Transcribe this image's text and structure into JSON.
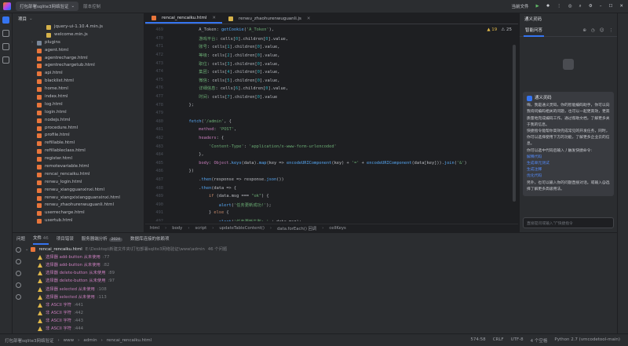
{
  "title_bar": {
    "project": "打包部署sqlite3网络验证",
    "branch": "版本控制",
    "run_config": "当前文件",
    "icons": [
      "run-icon",
      "debug-icon",
      "more-icon",
      "ai-icon",
      "search-icon",
      "settings-icon",
      "minimize-icon",
      "maximize-icon",
      "close-icon"
    ]
  },
  "project_panel": {
    "title": "项目",
    "items": [
      {
        "name": "jquery-ui-1.10.4.min.js",
        "type": "js",
        "indent": 3
      },
      {
        "name": "welcome.min.js",
        "type": "js",
        "indent": 3
      },
      {
        "name": "plugins",
        "type": "dir",
        "indent": 2,
        "chev": "›"
      },
      {
        "name": "agent.html",
        "type": "html",
        "indent": 2
      },
      {
        "name": "agentrecharge.html",
        "type": "html",
        "indent": 2
      },
      {
        "name": "agentrechargetub.html",
        "type": "html",
        "indent": 2
      },
      {
        "name": "api.html",
        "type": "html",
        "indent": 2
      },
      {
        "name": "blacklist.html",
        "type": "html",
        "indent": 2
      },
      {
        "name": "home.html",
        "type": "html",
        "indent": 2
      },
      {
        "name": "index.html",
        "type": "html",
        "indent": 2
      },
      {
        "name": "log.html",
        "type": "html",
        "indent": 2
      },
      {
        "name": "login.html",
        "type": "html",
        "indent": 2
      },
      {
        "name": "nodejs.html",
        "type": "html",
        "indent": 2
      },
      {
        "name": "procedure.html",
        "type": "html",
        "indent": 2
      },
      {
        "name": "profile.html",
        "type": "html",
        "indent": 2
      },
      {
        "name": "refillable.html",
        "type": "html",
        "indent": 2
      },
      {
        "name": "refillableclass.html",
        "type": "html",
        "indent": 2
      },
      {
        "name": "register.html",
        "type": "html",
        "indent": 2
      },
      {
        "name": "remotevariable.html",
        "type": "html",
        "indent": 2
      },
      {
        "name": "rencai_rencaiku.html",
        "type": "html",
        "indent": 2
      },
      {
        "name": "renwu_login.html",
        "type": "html",
        "indent": 2
      },
      {
        "name": "renwu_xiangguanxinxi.html",
        "type": "html",
        "indent": 2
      },
      {
        "name": "renwu_xiangxixiangguanxinxi.html",
        "type": "html",
        "indent": 2
      },
      {
        "name": "renwu_zhaohurenwuguanli.html",
        "type": "html",
        "indent": 2
      },
      {
        "name": "userrecharge.html",
        "type": "html",
        "indent": 2
      },
      {
        "name": "usertub.html",
        "type": "html",
        "indent": 2
      }
    ]
  },
  "editor": {
    "tabs": [
      {
        "label": "rencai_rencaiku.html",
        "active": true
      },
      {
        "label": "renwu_zhaohurenwuguanli.js",
        "active": false
      }
    ],
    "inspections": {
      "warnings": "▲ 19",
      "weak": "⚠ 25"
    },
    "lines": [
      {
        "no": "469",
        "html": "            A_Token: <span class=\"fn\">getCookie</span>(<span class=\"st\">'A_Token'</span>),"
      },
      {
        "no": "470",
        "html": "            <span class=\"st\">游戏平台</span>: cells[<span class=\"nm\">0</span>].children[<span class=\"nm\">0</span>].value,"
      },
      {
        "no": "471",
        "html": "            <span class=\"st\">账号</span>: cells[<span class=\"nm\">1</span>].children[<span class=\"nm\">0</span>].value,"
      },
      {
        "no": "472",
        "html": "            <span class=\"st\">等级</span>: cells[<span class=\"nm\">2</span>].children[<span class=\"nm\">0</span>].value,"
      },
      {
        "no": "473",
        "html": "            <span class=\"st\">职位</span>: cells[<span class=\"nm\">3</span>].children[<span class=\"nm\">0</span>].value,"
      },
      {
        "no": "474",
        "html": "            <span class=\"st\">集团</span>: cells[<span class=\"nm\">4</span>].children[<span class=\"nm\">0</span>].value,"
      },
      {
        "no": "475",
        "html": "            <span class=\"st\">微信</span>: cells[<span class=\"nm\">5</span>].children[<span class=\"nm\">0</span>].value,"
      },
      {
        "no": "476",
        "html": "            <span class=\"st\">详细信息</span>: cells[<span class=\"nm\">6</span>].children[<span class=\"nm\">0</span>].value,"
      },
      {
        "no": "477",
        "html": "            <span class=\"st\">时间</span>: cells[<span class=\"nm\">7</span>].children[<span class=\"nm\">0</span>].value"
      },
      {
        "no": "478",
        "html": "        };"
      },
      {
        "no": "479",
        "html": ""
      },
      {
        "no": "480",
        "html": "        <span class=\"fn\">fetch</span>(<span class=\"st\">'/admin'</span>, {"
      },
      {
        "no": "481",
        "html": "            <span class=\"pr\">method</span>: <span class=\"st\">'POST'</span>,"
      },
      {
        "no": "482",
        "html": "            <span class=\"pr\">headers</span>: {"
      },
      {
        "no": "483",
        "html": "                <span class=\"st\">'Content-Type'</span>: <span class=\"st\">'application/x-www-form-urlencoded'</span>"
      },
      {
        "no": "484",
        "html": "            },"
      },
      {
        "no": "485",
        "html": "            <span class=\"pr\">body</span>: <span class=\"ob\">Object</span>.<span class=\"fn\">keys</span>(data).<span class=\"fn\">map</span>(key => <span class=\"fn\">encodeURIComponent</span>(key) + <span class=\"st\">'='</span> + <span class=\"fn\">encodeURIComponent</span>(data[key])).<span class=\"fn\">join</span>(<span class=\"st\">'&'</span>)"
      },
      {
        "no": "486",
        "html": "        })"
      },
      {
        "no": "487",
        "html": "            .<span class=\"fn\">then</span>(response => response.<span class=\"fn\">json</span>())"
      },
      {
        "no": "488",
        "html": "            .<span class=\"fn\">then</span>(data => {"
      },
      {
        "no": "489",
        "html": "                <span class=\"kw\">if</span> (data.msg === <span class=\"st\">\"ok\"</span>) {"
      },
      {
        "no": "490",
        "html": "                    <span class=\"fn\">alert</span>(<span class=\"st\">'任务更新成功!'</span>);"
      },
      {
        "no": "491",
        "html": "                } <span class=\"kw\">else</span> {"
      },
      {
        "no": "492",
        "html": "                    <span class=\"fn\">alert</span>(<span class=\"st\">'任务更新失败: '</span> + data.msg);"
      },
      {
        "no": "493",
        "html": "                }"
      },
      {
        "no": "494",
        "html": "            })"
      },
      {
        "no": "495",
        "html": "            .<span class=\"fn\">catch</span>(error => {"
      }
    ],
    "breadcrumb": [
      "html",
      "body",
      "script",
      "updateTableContent()",
      "data.forEach() 回调",
      "cellKeys"
    ]
  },
  "ai_panel": {
    "title": "通义灵码",
    "tab": "智能问答",
    "card_who": "通义灵码",
    "card_text": "嗨，我是通义灵码，你的智能编码助手，你可以向我询问编码相关的问题，也可以一起更高效，更高质量地完成编码工作。通过帮助文档，了解更多关于我的信息。",
    "card_text2": "快捷指令能帮你高效完成常见的开发任务，同时，你可以选择使用下方的功能，了解更多企业云的信息。",
    "card_text3": "你可以选中代码后输入 / 触发快捷命令:",
    "links": [
      "解释代码",
      "生成单元测试",
      "生成注释",
      "优化代码"
    ],
    "card_text4": "另外，也可以输入你的问题直接对话。或输入@选择了解更多高级用法。",
    "input_placeholder": "直接提问或输入\"/\"快捷指令"
  },
  "problems": {
    "tabs": [
      "问题",
      "文件",
      "项目错误",
      "服务器端分析",
      "数据库连接的依赖项"
    ],
    "file_count": "46",
    "server_badge": "2024",
    "file": {
      "name": "rencai_rencaiku.html",
      "path": "E:\\Desktop\\新建文件夹\\打包部署sqlite3网络验证\\www\\admin",
      "count": "46 个问题"
    },
    "items": [
      {
        "text": "选择器 add-button 从未使用",
        "line": ":77"
      },
      {
        "text": "选择器 add-button 从未使用",
        "line": ":82"
      },
      {
        "text": "选择器 delete-button 从未使用",
        "line": ":89"
      },
      {
        "text": "选择器 delete-button 从未使用",
        "line": ":97"
      },
      {
        "text": "选择器 selected 从未使用",
        "line": ":108"
      },
      {
        "text": "选择器 selected 从未使用",
        "line": ":113"
      },
      {
        "text": "非 ASCII 字符",
        "line": ":441"
      },
      {
        "text": "非 ASCII 字符",
        "line": ":442"
      },
      {
        "text": "非 ASCII 字符",
        "line": ":443"
      },
      {
        "text": "非 ASCII 字符",
        "line": ":444"
      }
    ]
  },
  "status_bar": {
    "crumbs": [
      "打包部署sqlite3网络验证",
      "www",
      "admin",
      "rencai_rencaiku.html"
    ],
    "position": "574:58",
    "line_sep": "CRLF",
    "encoding": "UTF-8",
    "indent": "4 个空格",
    "interpreter": "Python 2.7 (vmcodetool-main)"
  },
  "colors": {
    "accent": "#3574f0",
    "warning": "#e0b84a"
  }
}
